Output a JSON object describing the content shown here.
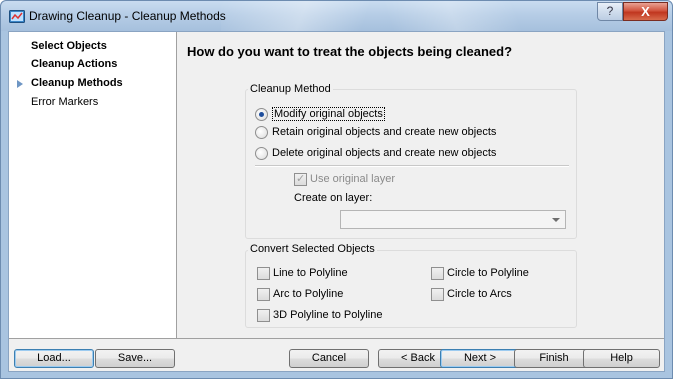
{
  "window": {
    "title": "Drawing Cleanup - Cleanup Methods",
    "help_glyph": "?",
    "close_glyph": "X"
  },
  "sidebar": {
    "items": [
      {
        "label": "Select Objects",
        "bold": true,
        "current": false
      },
      {
        "label": "Cleanup Actions",
        "bold": true,
        "current": false
      },
      {
        "label": "Cleanup Methods",
        "bold": true,
        "current": true
      },
      {
        "label": "Error Markers",
        "bold": false,
        "current": false
      }
    ]
  },
  "main": {
    "heading": "How do you want to treat the objects being cleaned?",
    "cleanup_method": {
      "legend": "Cleanup Method",
      "options": [
        {
          "label": "Modify original objects",
          "checked": true
        },
        {
          "label": "Retain original objects and create new objects",
          "checked": false
        },
        {
          "label": "Delete original objects and create new objects",
          "checked": false
        }
      ],
      "use_original_layer": {
        "label": "Use original layer",
        "checked": true,
        "enabled": false
      },
      "create_on_layer": {
        "label": "Create on layer:",
        "value": "",
        "enabled": false
      }
    },
    "convert": {
      "legend": "Convert Selected Objects",
      "options": [
        {
          "label": "Line to Polyline",
          "checked": false
        },
        {
          "label": "Circle to Polyline",
          "checked": false
        },
        {
          "label": "Arc to Polyline",
          "checked": false
        },
        {
          "label": "Circle to Arcs",
          "checked": false
        },
        {
          "label": "3D Polyline to Polyline",
          "checked": false
        }
      ]
    }
  },
  "buttons": {
    "load": "Load...",
    "save": "Save...",
    "cancel": "Cancel",
    "back": "< Back",
    "next": "Next >",
    "finish": "Finish",
    "help": "Help"
  },
  "colors": {
    "accent": "#1f4e9c",
    "close_button": "#c0361f",
    "titlebar": "#b6cde6"
  }
}
